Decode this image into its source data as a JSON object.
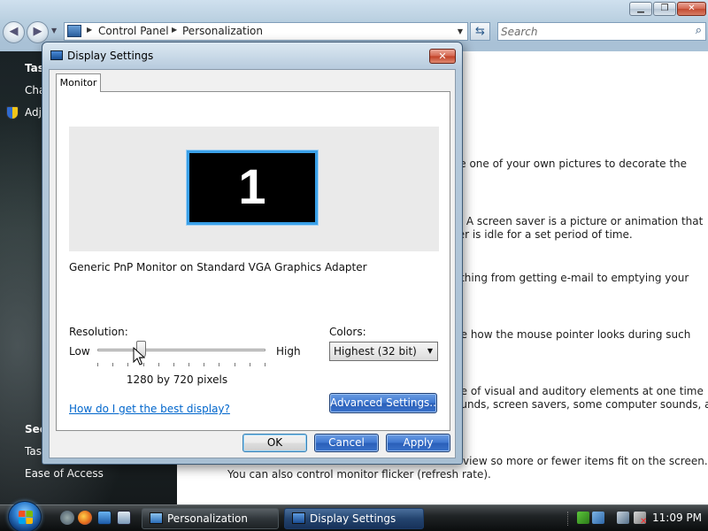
{
  "explorer": {
    "breadcrumbs": [
      "Control Panel",
      "Personalization"
    ],
    "search_placeholder": "Search",
    "nav_pane": {
      "items": [
        {
          "label": "Tas",
          "bold": true
        },
        {
          "label": "Cha",
          "bold": false
        },
        {
          "label": "Adj",
          "bold": false
        },
        {
          "label": "See",
          "bold": true
        },
        {
          "label": "Tas",
          "bold": false
        },
        {
          "label": "Ease of Access",
          "bold": false
        }
      ]
    },
    "content_lines": [
      "se one of your own pictures to decorate the",
      "s. A screen saver is a picture or animation that",
      "ter is idle for a set period of time.",
      "ything from getting e-mail to emptying your",
      "ge how the mouse pointer looks during such",
      "ge of visual and auditory elements at one time",
      "ounds, screen savers, some computer sounds, and",
      "view so more or fewer items fit on the screen.",
      "You can also control monitor flicker (refresh rate)."
    ]
  },
  "dialog": {
    "title": "Display Settings",
    "close_label": "✕",
    "tab": "Monitor",
    "monitor_number": "1",
    "adapter": "Generic PnP Monitor on Standard VGA Graphics Adapter",
    "resolution": {
      "label": "Resolution:",
      "low": "Low",
      "high": "High",
      "value": "1280 by 720 pixels",
      "slider_fraction": 0.26
    },
    "colors": {
      "label": "Colors:",
      "selected": "Highest (32 bit)"
    },
    "help_link": "How do I get the best display?",
    "advanced_button": "Advanced Settings...",
    "ok_button": "OK",
    "cancel_button": "Cancel",
    "apply_button": "Apply"
  },
  "taskbar": {
    "tasks": [
      {
        "label": "Personalization",
        "active": false
      },
      {
        "label": "Display Settings",
        "active": true
      }
    ],
    "clock": "11:09 PM"
  },
  "colors": {
    "monitor_highlight": "#3aa0e8",
    "link": "#0066cc",
    "active_button": "#3f78d1"
  }
}
